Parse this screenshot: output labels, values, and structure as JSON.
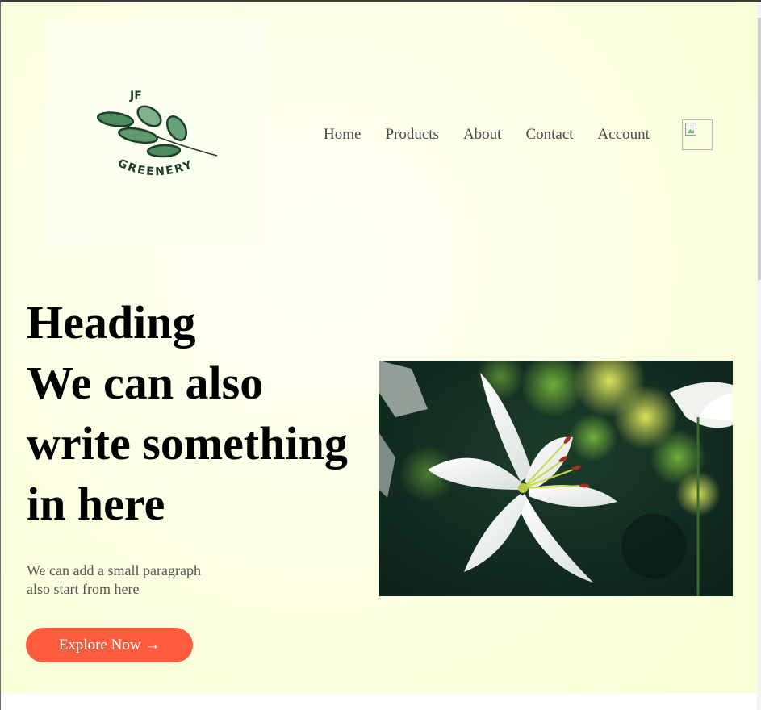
{
  "logo": {
    "top_text": "JF",
    "bottom_text": "GREENERY"
  },
  "nav": {
    "items": [
      "Home",
      "Products",
      "About",
      "Contact",
      "Account"
    ],
    "cart_icon": "broken-image-icon"
  },
  "hero": {
    "heading_lines": [
      "Heading",
      "We can also",
      "write something",
      "in here"
    ],
    "paragraph_lines": [
      "We can add a small paragraph",
      "also start from here"
    ],
    "cta_label": "Explore Now →",
    "cta_color": "#ff5b3d",
    "photo_subject": "white-lily-flower"
  },
  "colors": {
    "background": "#f8ffd2",
    "logo_bg": "#fbfff0",
    "leaf_dark": "#2f5e3a",
    "leaf_light": "#6aa37a"
  }
}
